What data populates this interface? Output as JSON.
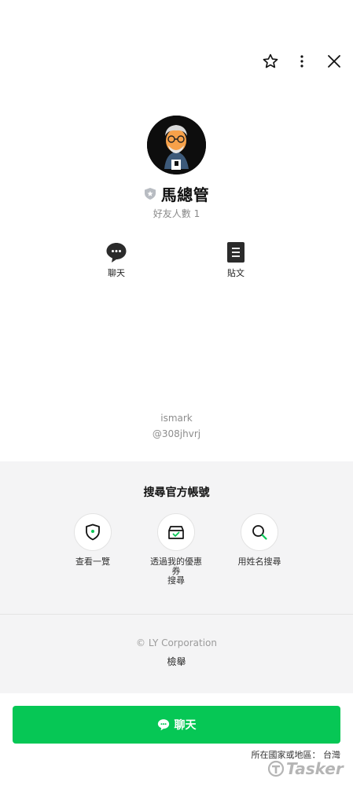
{
  "profile": {
    "name": "馬總管",
    "friends": "好友人數 1",
    "user_id": "ismark",
    "line_id": "@308jhvrj"
  },
  "actions": {
    "chat": "聊天",
    "posts": "貼文"
  },
  "search_section": {
    "title": "搜尋官方帳號",
    "options": [
      {
        "label": "查看一覽",
        "icon": "shield-list-icon"
      },
      {
        "label_line1": "透過我的優惠",
        "label_line2": "券",
        "label_line3": "搜尋",
        "icon": "coupon-icon"
      },
      {
        "label": "用姓名搜尋",
        "icon": "search-icon"
      }
    ]
  },
  "footer": {
    "copyright": "© LY Corporation",
    "report": "檢舉"
  },
  "chat_button": {
    "label": "聊天"
  },
  "region": "所在國家或地區： 台灣",
  "watermark": "Tasker",
  "colors": {
    "accent": "#06c755",
    "section_bg": "#f4f4f5",
    "muted_text": "#8a8a8a"
  }
}
